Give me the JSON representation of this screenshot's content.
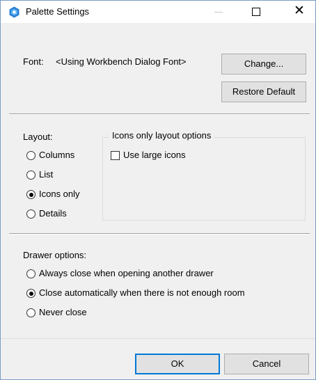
{
  "window": {
    "title": "Palette Settings",
    "icon": "palette-gear-icon"
  },
  "font_section": {
    "label": "Font:",
    "value": "<Using Workbench Dialog Font>",
    "change_button": "Change...",
    "restore_button": "Restore Default"
  },
  "layout": {
    "label": "Layout:",
    "options": [
      {
        "label": "Columns",
        "selected": false
      },
      {
        "label": "List",
        "selected": false
      },
      {
        "label": "Icons only",
        "selected": true
      },
      {
        "label": "Details",
        "selected": false
      }
    ],
    "icons_group": {
      "title": "Icons only layout options",
      "checkbox_label": "Use large icons",
      "checked": false
    }
  },
  "drawer": {
    "label": "Drawer options:",
    "options": [
      {
        "label": "Always close when opening another drawer",
        "selected": false
      },
      {
        "label": "Close automatically when there is not enough room",
        "selected": true
      },
      {
        "label": "Never close",
        "selected": false
      }
    ]
  },
  "footer": {
    "ok": "OK",
    "cancel": "Cancel"
  },
  "colors": {
    "accent": "#0078d7",
    "icon_blue": "#1e88e5"
  }
}
